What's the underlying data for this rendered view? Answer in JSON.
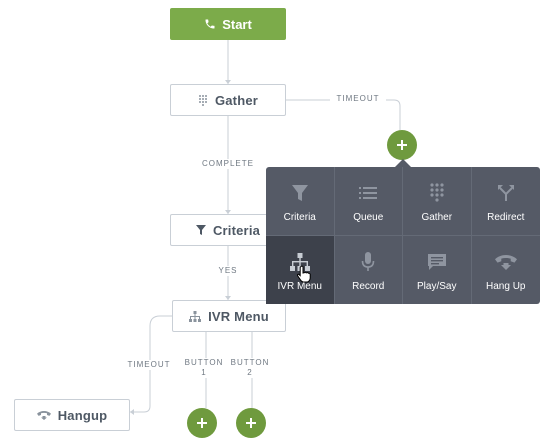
{
  "nodes": {
    "start": "Start",
    "gather": "Gather",
    "criteria": "Criteria",
    "ivr_menu": "IVR Menu",
    "hangup": "Hangup"
  },
  "wire_labels": {
    "gather_timeout": "TIMEOUT",
    "gather_complete": "COMPLETE",
    "criteria_yes": "YES",
    "ivr_timeout": "TIMEOUT",
    "ivr_button1_line1": "BUTTON",
    "ivr_button1_line2": "1",
    "ivr_button2_line1": "BUTTON",
    "ivr_button2_line2": "2"
  },
  "add_menu": {
    "items": [
      {
        "label": "Criteria",
        "icon": "filter-icon"
      },
      {
        "label": "Queue",
        "icon": "list-icon"
      },
      {
        "label": "Gather",
        "icon": "keypad-icon"
      },
      {
        "label": "Redirect",
        "icon": "split-arrow-icon"
      },
      {
        "label": "IVR Menu",
        "icon": "sitemap-icon",
        "active": true
      },
      {
        "label": "Record",
        "icon": "microphone-icon"
      },
      {
        "label": "Play/Say",
        "icon": "speech-bubble-icon"
      },
      {
        "label": "Hang Up",
        "icon": "hangup-phone-icon"
      }
    ]
  },
  "colors": {
    "start_green": "#7cab4a",
    "add_green": "#6f9a3e",
    "menu_bg": "#555a66",
    "menu_active_bg": "#3d414b",
    "node_border": "#c9cfd6",
    "wire": "#c9cfd6"
  }
}
